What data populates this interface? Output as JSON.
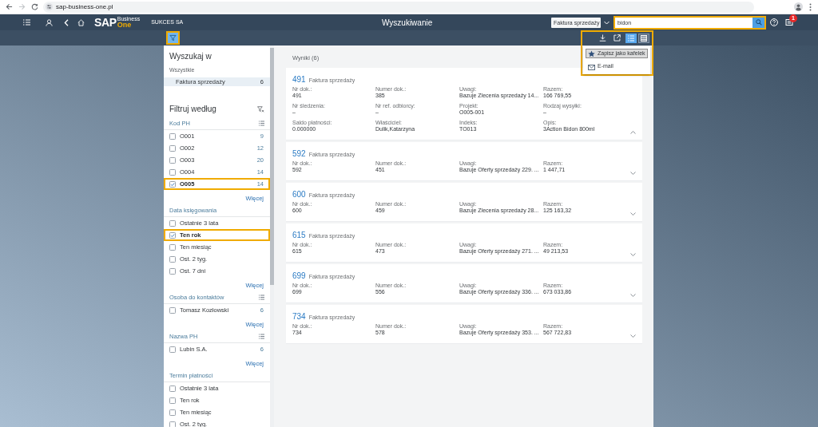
{
  "browser": {
    "url": "sap-business-one.pl"
  },
  "header": {
    "logo": {
      "wordmark": "SAP",
      "caption_top": "Business",
      "caption_bottom": "One"
    },
    "company": "SUKCES SA",
    "title": "Wyszukiwanie",
    "scope": "Faktura sprzedaży",
    "search": {
      "value": "bidon",
      "highlighted": true
    },
    "notification_count": "1"
  },
  "toolbar": {
    "filter_button": {
      "selected": true,
      "highlighted": true
    },
    "actions_highlighted": true,
    "views": [
      {
        "kind": "list",
        "selected": true
      },
      {
        "kind": "table",
        "selected": false
      }
    ],
    "menu": [
      {
        "kind": "tile",
        "label": "Zapisz jako kafelek",
        "selected": true
      },
      {
        "kind": "email",
        "label": "E-mail",
        "selected": false
      }
    ]
  },
  "filter_panel": {
    "search_in": {
      "title": "Wyszukaj w",
      "all_label": "Wszystkie",
      "items": [
        {
          "label": "Faktura sprzedaży",
          "count": "6",
          "selected": true
        }
      ]
    },
    "filter_title": "Filtruj według",
    "groups": [
      {
        "title": "Kod PH",
        "list_icon": true,
        "items": [
          {
            "label": "O001",
            "count": "9",
            "checked": false,
            "highlighted": false
          },
          {
            "label": "O002",
            "count": "12",
            "checked": false,
            "highlighted": false
          },
          {
            "label": "O003",
            "count": "20",
            "checked": false,
            "highlighted": false
          },
          {
            "label": "O004",
            "count": "14",
            "checked": false,
            "highlighted": false
          },
          {
            "label": "O005",
            "count": "14",
            "checked": true,
            "highlighted": true
          }
        ],
        "more": "Więcej"
      },
      {
        "title": "Data księgowania",
        "list_icon": false,
        "items": [
          {
            "label": "Ostatnie 3 lata",
            "checked": false,
            "highlighted": false
          },
          {
            "label": "Ten rok",
            "checked": true,
            "highlighted": true
          },
          {
            "label": "Ten miesiąc",
            "checked": false,
            "highlighted": false
          },
          {
            "label": "Ost. 2 tyg.",
            "checked": false,
            "highlighted": false
          },
          {
            "label": "Ost. 7 dni",
            "checked": false,
            "highlighted": false
          }
        ],
        "more": "Więcej"
      },
      {
        "title": "Osoba do kontaktów",
        "list_icon": true,
        "items": [
          {
            "label": "Tomasz Kozłowski",
            "count": "6",
            "checked": false,
            "highlighted": false
          }
        ],
        "more": "Więcej"
      },
      {
        "title": "Nazwa PH",
        "list_icon": true,
        "items": [
          {
            "label": "Lubin S.A.",
            "count": "6",
            "checked": false,
            "highlighted": false
          }
        ],
        "more": "Więcej"
      },
      {
        "title": "Termin płatności",
        "list_icon": false,
        "items": [
          {
            "label": "Ostatnie 3 lata",
            "checked": false,
            "highlighted": false
          },
          {
            "label": "Ten rok",
            "checked": false,
            "highlighted": false
          },
          {
            "label": "Ten miesiąc",
            "checked": false,
            "highlighted": false
          },
          {
            "label": "Ost. 2 tyg.",
            "checked": false,
            "highlighted": false
          }
        ]
      }
    ]
  },
  "results": {
    "title": "Wyniki (6)",
    "cards": [
      {
        "number": "491",
        "type": "Faktura sprzedaży",
        "expanded": true,
        "fields": [
          {
            "label": "Nr dok.:",
            "value": "491"
          },
          {
            "label": "Numer dok.:",
            "value": "385"
          },
          {
            "label": "Uwagi:",
            "value": "Bazuje Zlecenia sprzedaży 14..."
          },
          {
            "label": "Razem:",
            "value": "166 769,55"
          },
          {
            "label": "Nr śledzenia:",
            "value": "–"
          },
          {
            "label": "Nr ref. odbiorcy:",
            "value": "–"
          },
          {
            "label": "Projekt:",
            "value": "O005-001"
          },
          {
            "label": "Rodzaj wysyłki:",
            "value": "–"
          },
          {
            "label": "Saldo płatności:",
            "value": "0.000000"
          },
          {
            "label": "Właściciel:",
            "value": "Dulik,Katarzyna"
          },
          {
            "label": "Indeks:",
            "value": "TO013"
          },
          {
            "label": "Opis:",
            "value": "3Action Bidon 800ml"
          }
        ]
      },
      {
        "number": "592",
        "type": "Faktura sprzedaży",
        "expanded": false,
        "fields": [
          {
            "label": "Nr dok.:",
            "value": "592"
          },
          {
            "label": "Numer dok.:",
            "value": "451"
          },
          {
            "label": "Uwagi:",
            "value": "Bazuje Oferty sprzedaży 229. ..."
          },
          {
            "label": "Razem:",
            "value": "1 447,71"
          }
        ]
      },
      {
        "number": "600",
        "type": "Faktura sprzedaży",
        "expanded": false,
        "fields": [
          {
            "label": "Nr dok.:",
            "value": "600"
          },
          {
            "label": "Numer dok.:",
            "value": "459"
          },
          {
            "label": "Uwagi:",
            "value": "Bazuje Zlecenia sprzedaży 28..."
          },
          {
            "label": "Razem:",
            "value": "125 163,32"
          }
        ]
      },
      {
        "number": "615",
        "type": "Faktura sprzedaży",
        "expanded": false,
        "fields": [
          {
            "label": "Nr dok.:",
            "value": "615"
          },
          {
            "label": "Numer dok.:",
            "value": "473"
          },
          {
            "label": "Uwagi:",
            "value": "Bazuje Oferty sprzedaży 271. ..."
          },
          {
            "label": "Razem:",
            "value": "49 213,53"
          }
        ]
      },
      {
        "number": "699",
        "type": "Faktura sprzedaży",
        "expanded": false,
        "fields": [
          {
            "label": "Nr dok.:",
            "value": "699"
          },
          {
            "label": "Numer dok.:",
            "value": "556"
          },
          {
            "label": "Uwagi:",
            "value": "Bazuje Oferty sprzedaży 336. ..."
          },
          {
            "label": "Razem:",
            "value": "673 033,86"
          }
        ]
      },
      {
        "number": "734",
        "type": "Faktura sprzedaży",
        "expanded": false,
        "fields": [
          {
            "label": "Nr dok.:",
            "value": "734"
          },
          {
            "label": "Numer dok.:",
            "value": "578"
          },
          {
            "label": "Uwagi:",
            "value": "Bazuje Oferty sprzedaży 353. ..."
          },
          {
            "label": "Razem:",
            "value": "567 722,83"
          }
        ]
      }
    ]
  }
}
